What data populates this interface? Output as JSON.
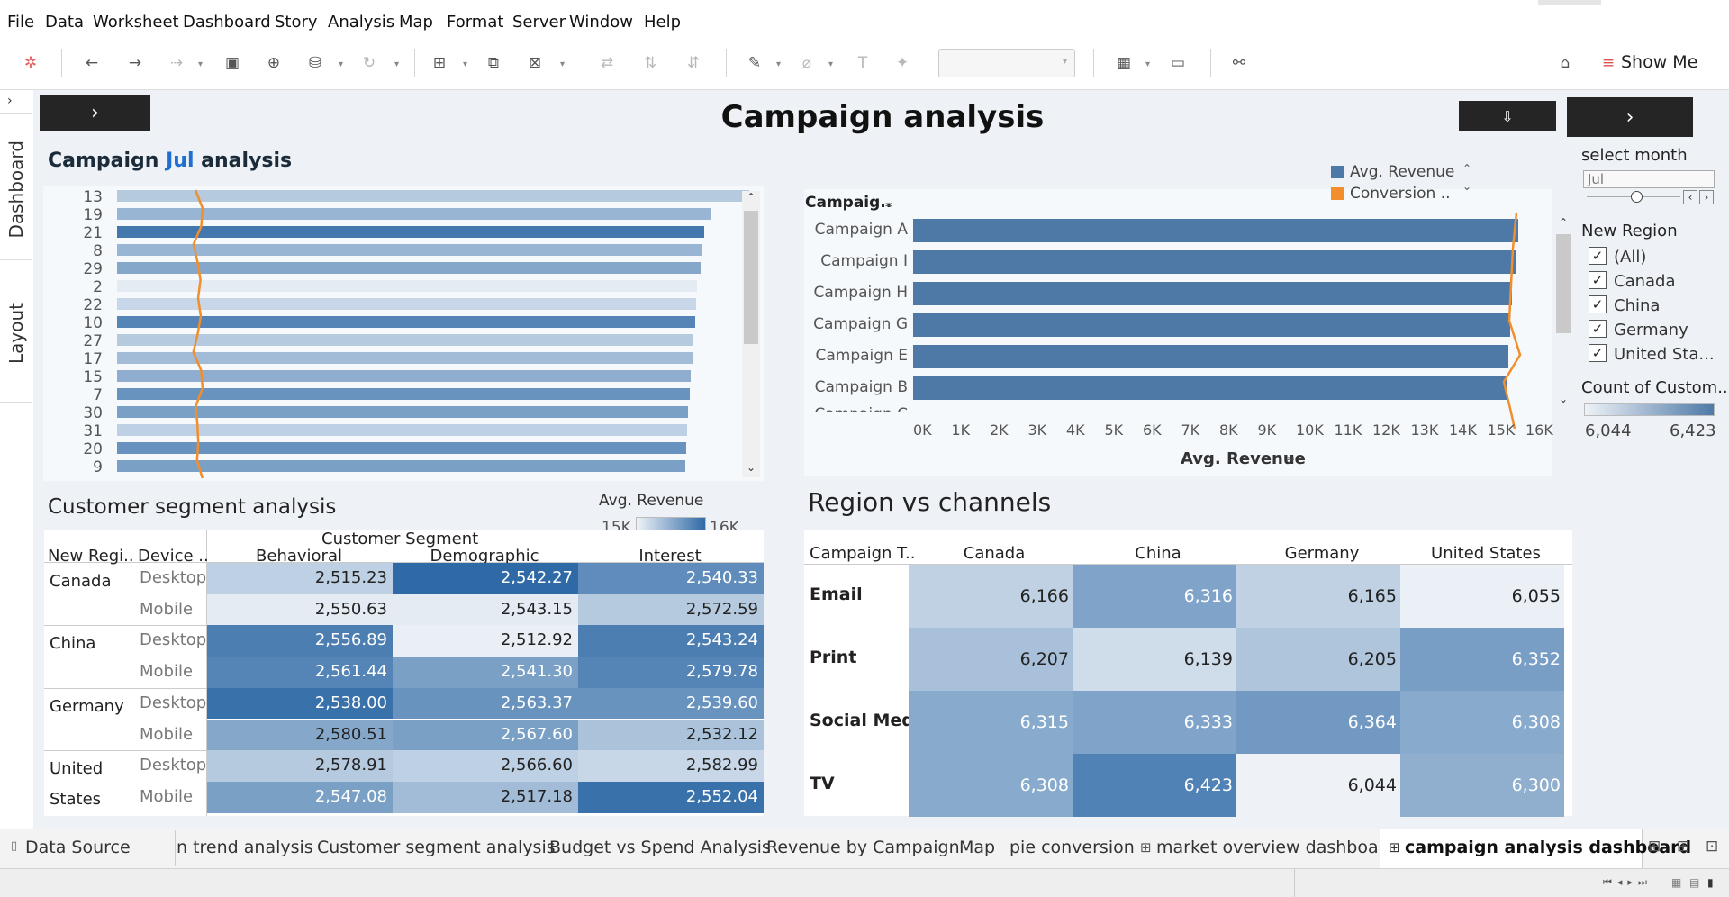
{
  "menu": [
    "File",
    "Data",
    "Worksheet",
    "Dashboard",
    "Story",
    "Analysis",
    "Map",
    "Format",
    "Server",
    "Window",
    "Help"
  ],
  "toolbar": {
    "show_me_label": "Show Me"
  },
  "left_tabs": [
    "Dashboard",
    "Layout"
  ],
  "dashboard_title": "Campaign analysis",
  "jul_chart": {
    "title_prefix": "Campaign ",
    "title_month": "Jul",
    "title_suffix": " analysis",
    "rows": [
      "13",
      "19",
      "21",
      "8",
      "29",
      "2",
      "22",
      "10",
      "27",
      "17",
      "15",
      "7",
      "30",
      "31",
      "20",
      "9"
    ],
    "values": [
      0.975,
      0.915,
      0.905,
      0.902,
      0.9,
      0.895,
      0.893,
      0.891,
      0.889,
      0.887,
      0.885,
      0.883,
      0.881,
      0.879,
      0.878,
      0.877
    ],
    "color_level": [
      0.3,
      0.45,
      0.9,
      0.45,
      0.55,
      0.05,
      0.2,
      0.8,
      0.3,
      0.4,
      0.5,
      0.7,
      0.6,
      0.25,
      0.7,
      0.6
    ]
  },
  "revenue_chart": {
    "field_header": "Campaig..",
    "legend": [
      {
        "name": "Avg. Revenue",
        "color": "#4e79a7"
      },
      {
        "name": "Conversion ..",
        "color": "#f28e2b"
      }
    ],
    "categories": [
      "Campaign A",
      "Campaign I",
      "Campaign H",
      "Campaign G",
      "Campaign E",
      "Campaign B"
    ],
    "partial_label": "Campaign C",
    "values": [
      15800,
      15750,
      15650,
      15600,
      15550,
      15500
    ],
    "ticks": [
      "0K",
      "1K",
      "2K",
      "3K",
      "4K",
      "5K",
      "6K",
      "7K",
      "8K",
      "9K",
      "10K",
      "11K",
      "12K",
      "13K",
      "14K",
      "15K",
      "16K"
    ],
    "xlabel": "Avg. Revenue"
  },
  "segment": {
    "title": "Customer segment analysis",
    "legend_title": "Avg. Revenue",
    "legend_min": "15K",
    "legend_max": "16K",
    "col_header_group": "Customer Segment",
    "headers": [
      "New Regi..",
      "Device ..",
      "Behavioral",
      "Demographic",
      "Interest"
    ],
    "rows": [
      {
        "region": "Canada",
        "device": "Desktop",
        "values": [
          "2,515.23",
          "2,542.27",
          "2,540.33"
        ],
        "levels": [
          0.25,
          1.0,
          0.75
        ]
      },
      {
        "region": "",
        "device": "Mobile",
        "values": [
          "2,550.63",
          "2,543.15",
          "2,572.59"
        ],
        "levels": [
          0.05,
          0.05,
          0.3
        ]
      },
      {
        "region": "China",
        "device": "Desktop",
        "values": [
          "2,556.89",
          "2,512.92",
          "2,543.24"
        ],
        "levels": [
          0.85,
          0.02,
          0.85
        ]
      },
      {
        "region": "",
        "device": "Mobile",
        "values": [
          "2,561.44",
          "2,541.30",
          "2,579.78"
        ],
        "levels": [
          0.8,
          0.6,
          0.8
        ]
      },
      {
        "region": "Germany",
        "device": "Desktop",
        "values": [
          "2,538.00",
          "2,563.37",
          "2,539.60"
        ],
        "levels": [
          0.95,
          0.7,
          0.7
        ]
      },
      {
        "region": "",
        "device": "Mobile",
        "values": [
          "2,580.51",
          "2,567.60",
          "2,532.12"
        ],
        "levels": [
          0.55,
          0.6,
          0.35
        ]
      },
      {
        "region": "United States",
        "device": "Desktop",
        "values": [
          "2,578.91",
          "2,566.60",
          "2,582.99"
        ],
        "levels": [
          0.3,
          0.25,
          0.2
        ]
      },
      {
        "region": "",
        "device": "Mobile",
        "values": [
          "2,547.08",
          "2,517.18",
          "2,552.04"
        ],
        "levels": [
          0.6,
          0.4,
          0.95
        ]
      }
    ]
  },
  "region_channels": {
    "title": "Region vs channels",
    "headers": [
      "Campaign T..",
      "Canada",
      "China",
      "Germany",
      "United States"
    ],
    "rows": [
      {
        "label": "Email",
        "values": [
          "6,166",
          "6,316",
          "6,165",
          "6,055"
        ],
        "levels": [
          0.3,
          0.7,
          0.3,
          0.02
        ]
      },
      {
        "label": "Print",
        "values": [
          "6,207",
          "6,139",
          "6,205",
          "6,352"
        ],
        "levels": [
          0.45,
          0.2,
          0.4,
          0.75
        ]
      },
      {
        "label": "Social Media",
        "values": [
          "6,315",
          "6,333",
          "6,364",
          "6,308"
        ],
        "levels": [
          0.65,
          0.7,
          0.8,
          0.65
        ]
      },
      {
        "label": "TV",
        "values": [
          "6,308",
          "6,423",
          "6,044",
          "6,300"
        ],
        "levels": [
          0.65,
          1.0,
          0.0,
          0.6
        ]
      }
    ]
  },
  "filters": {
    "select_month_label": "select month",
    "select_month_value": "Jul",
    "region_title": "New Region",
    "region_items": [
      "(All)",
      "Canada",
      "China",
      "Germany",
      "United Sta..."
    ],
    "count_title": "Count of Custom..",
    "count_min": "6,044",
    "count_max": "6,423"
  },
  "sheet_tabs": [
    "Data Source",
    "n trend analysis",
    "Customer segment analysis",
    "Budget vs Spend Analysis",
    "Revenue  by Campaign",
    "Map",
    "pie conversion",
    "market overview dashboard",
    "campaign analysis dashboard"
  ],
  "colors": {
    "blue_dark": "#2f6aa6",
    "blue_light": "#eef2f7",
    "orange": "#f28e2b",
    "title_blue": "#1f6fd0"
  }
}
